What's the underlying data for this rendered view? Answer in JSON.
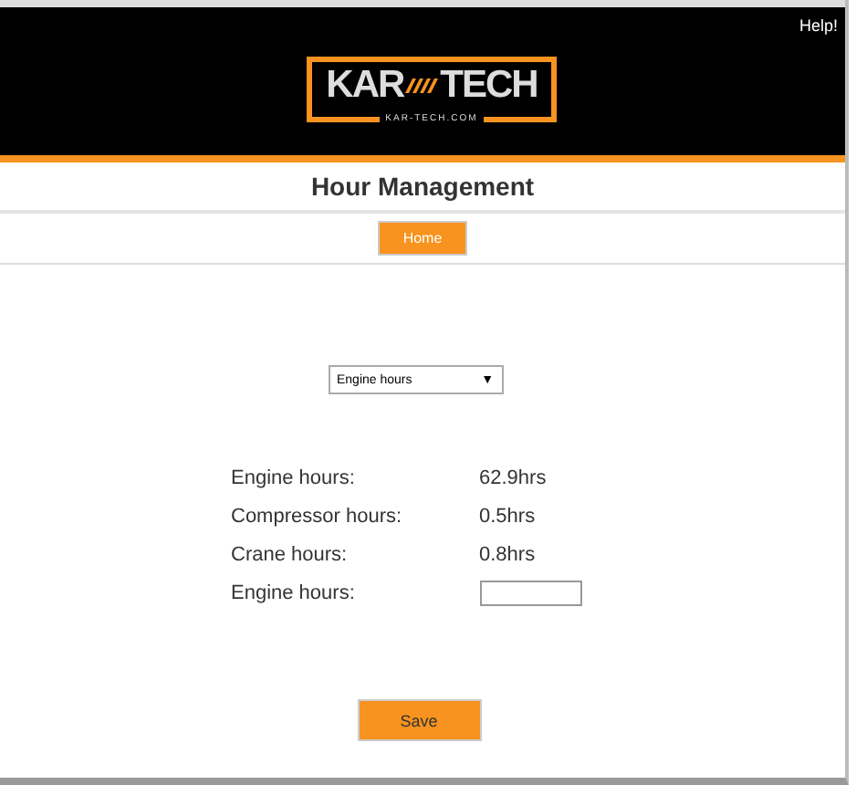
{
  "header": {
    "help_link": "Help!",
    "logo": {
      "left": "KAR",
      "right": "TECH",
      "url": "KAR-TECH.COM"
    }
  },
  "page_title": "Hour Management",
  "nav": {
    "home_button": "Home"
  },
  "select": {
    "value": "Engine hours",
    "arrow": "▼"
  },
  "readings": [
    {
      "kind": "text",
      "label": "Engine hours:",
      "value": "62.9hrs"
    },
    {
      "kind": "text",
      "label": "Compressor hours:",
      "value": "0.5hrs"
    },
    {
      "kind": "text",
      "label": "Crane hours:",
      "value": "0.8hrs"
    },
    {
      "kind": "input",
      "label": "Engine hours:"
    }
  ],
  "save_button": "Save"
}
